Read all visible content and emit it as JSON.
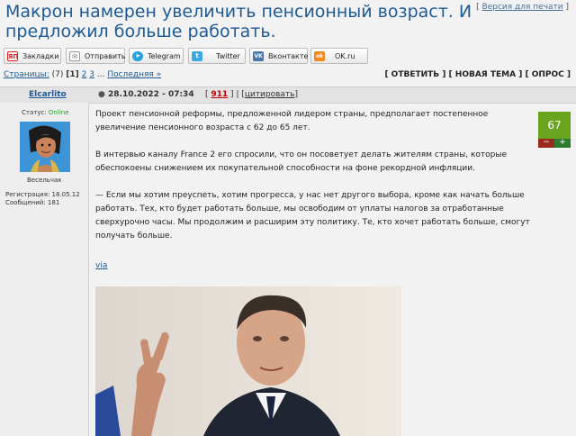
{
  "topic": {
    "title": "Макрон намерен увеличить пенсионный возраст. И предложил больше работать.",
    "print_version": "Версия для печати"
  },
  "share": [
    {
      "icon": "yandex-bookmarks-icon",
      "icon_text": "ЯП",
      "label": "Закладки",
      "color": "#e02020"
    },
    {
      "icon": "mail-icon",
      "icon_text": "✉",
      "label": "Отправить",
      "color": "#777777"
    },
    {
      "icon": "telegram-icon",
      "icon_text": "➤",
      "label": "Telegram",
      "color": "#2aa3dd"
    },
    {
      "icon": "twitter-icon",
      "icon_text": "t",
      "label": "Twitter",
      "color": "#3aa9e6"
    },
    {
      "icon": "vk-icon",
      "icon_text": "VK",
      "label": "Вконтакте",
      "color": "#4a76a8"
    },
    {
      "icon": "ok-icon",
      "icon_text": "ok",
      "label": "OK.ru",
      "color": "#f08a1a"
    }
  ],
  "pagination": {
    "label": "Страницы:",
    "count": "(7)",
    "current": "[1]",
    "p2": "2",
    "p3": "3",
    "ellipsis": "...",
    "last": "Последняя »"
  },
  "actions": {
    "reply": "[ ОТВЕТИТЬ ]",
    "new_topic": "[ НОВАЯ ТЕМА ]",
    "poll": "[ ОПРОС ]"
  },
  "post": {
    "author": "Elcarlito",
    "date": "28.10.2022 - 07:34",
    "number": "911",
    "quote": "цитировать",
    "status_label": "Статус:",
    "status_value": "Online",
    "rank": "Весельчак",
    "registration": "Регистрация: 18.05.12",
    "messages": "Сообщений: 181",
    "p1": "Проект пенсионной реформы, предложенной лидером страны, предполагает постепенное увеличение пенсионного возраста с 62 до 65 лет.",
    "p2": "В интервью каналу France 2 его спросили, что он посоветует делать жителям страны, которые обеспокоены снижением их покупательной способности на фоне рекордной инфляции.",
    "p3": "— Если мы хотим преуспеть, хотим прогресса, у нас нет другого выбора, кроме как начать больше работать. Тех, кто будет работать больше, мы освободим от уплаты налогов за отработанные сверхурочно часы. Мы продолжим и расширим эту политику. Те, кто хочет работать больше, смогут получать больше.",
    "via": "via",
    "rating": "67",
    "minus": "−",
    "plus": "+"
  }
}
